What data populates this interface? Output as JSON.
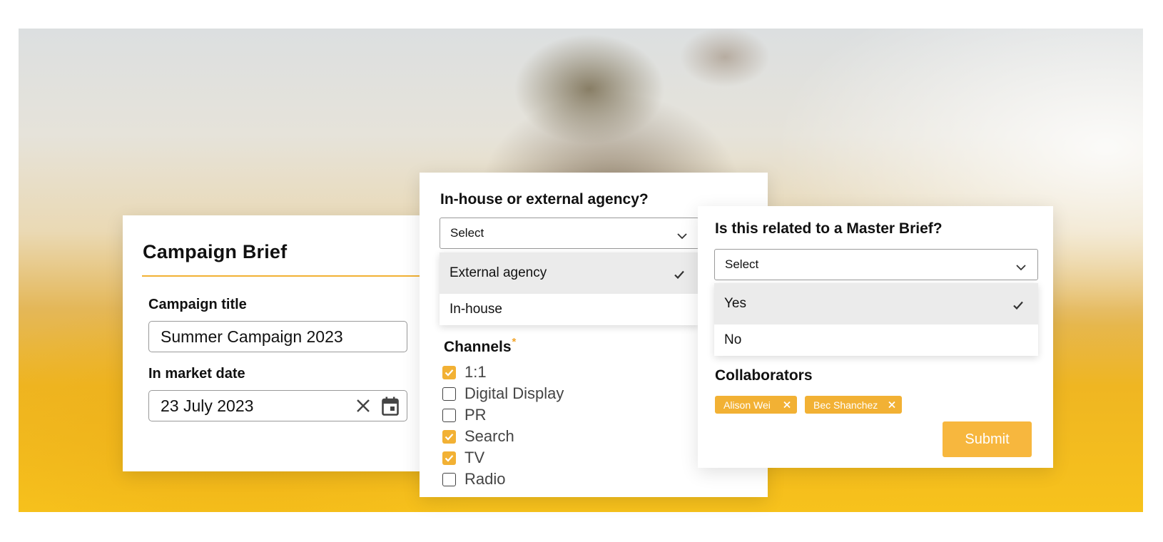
{
  "colors": {
    "accent": "#f2b134",
    "check_bg": "#f2b134",
    "selected_option_bg": "#ebebeb"
  },
  "campaign_brief": {
    "title": "Campaign Brief",
    "campaign_title_label": "Campaign title",
    "campaign_title_value": "Summer Campaign 2023",
    "in_market_date_label": "In market date",
    "in_market_date_value": "23 July 2023",
    "clear_icon": "close-icon",
    "calendar_icon": "calendar-icon"
  },
  "agency": {
    "question": "In-house or external agency?",
    "select_value": "Select",
    "options": [
      {
        "label": "External agency",
        "selected": true
      },
      {
        "label": "In-house",
        "selected": false
      }
    ]
  },
  "channels": {
    "label": "Channels",
    "required_marker": "*",
    "items": [
      {
        "label": "1:1",
        "checked": true
      },
      {
        "label": "Digital Display",
        "checked": false
      },
      {
        "label": "PR",
        "checked": false
      },
      {
        "label": "Search",
        "checked": true
      },
      {
        "label": "TV",
        "checked": true
      },
      {
        "label": "Radio",
        "checked": false
      }
    ]
  },
  "master_brief": {
    "question": "Is this related to a Master Brief?",
    "select_value": "Select",
    "options": [
      {
        "label": "Yes",
        "selected": true
      },
      {
        "label": "No",
        "selected": false
      }
    ]
  },
  "collaborators": {
    "label": "Collaborators",
    "chips": [
      "Alison Wei",
      "Bec Shanchez"
    ]
  },
  "submit_label": "Submit"
}
